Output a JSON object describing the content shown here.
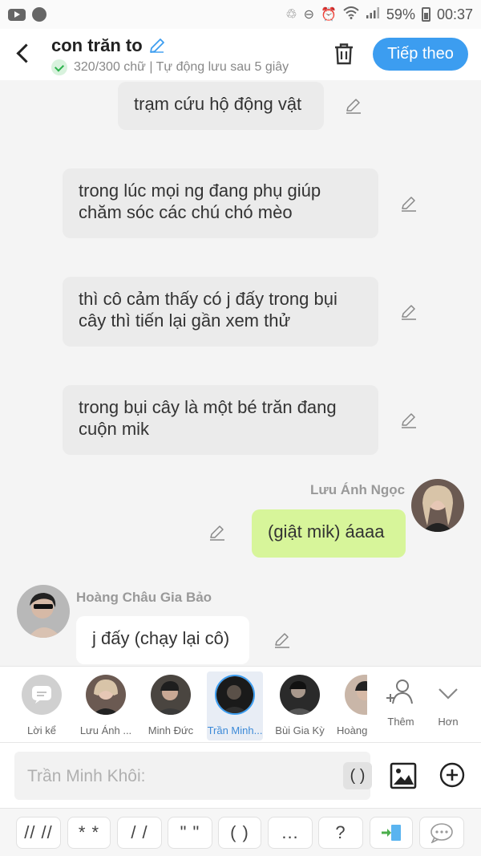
{
  "status_bar": {
    "battery": "59%",
    "time": "00:37"
  },
  "header": {
    "title": "con trăn to",
    "subtitle": "320/300 chữ | Tự động lưu sau 5 giây",
    "next_label": "Tiếp theo"
  },
  "messages": [
    {
      "text": "trạm cứu hộ động vật"
    },
    {
      "text": "trong lúc mọi ng đang phụ giúp chăm sóc các chú chó mèo"
    },
    {
      "text": "thì cô cảm thấy có j đấy trong bụi cây thì tiến lại gần xem thử"
    },
    {
      "text": "trong bụi cây là một bé trăn đang cuộn mik"
    },
    {
      "sender": "Lưu Ánh Ngọc",
      "text": "(giật mik) áaaa"
    },
    {
      "sender": "Hoàng Châu Gia Bảo",
      "text": "j đấy (chạy lại cô)"
    }
  ],
  "members": [
    {
      "label": "Lời kể"
    },
    {
      "label": "Lưu Ánh ..."
    },
    {
      "label": "Minh Đức"
    },
    {
      "label": "Trần Minh..."
    },
    {
      "label": "Bùi Gia Kỳ"
    },
    {
      "label": "Hoàng"
    },
    {
      "label": "Thêm"
    },
    {
      "label": "Hơn"
    }
  ],
  "composer": {
    "placeholder": "Trần Minh Khôi:",
    "paren_chip": "( )"
  },
  "quick_chips": [
    "// //",
    "* *",
    "/ /",
    "\" \"",
    "( )",
    "...",
    "?"
  ],
  "colors": {
    "accent": "#3c9df0",
    "green_bubble": "#d7f59a",
    "grey_bubble": "#ebebeb"
  }
}
